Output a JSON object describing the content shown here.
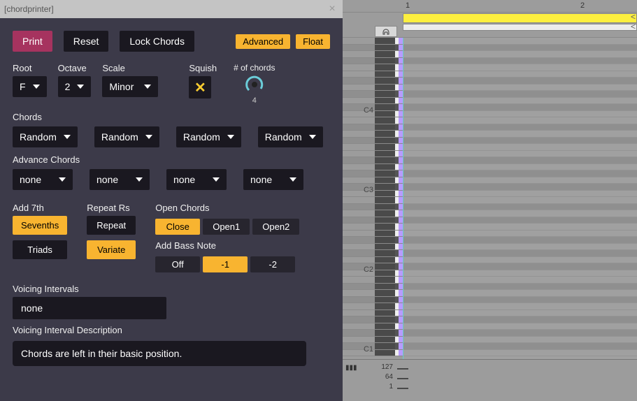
{
  "titlebar": {
    "text": "[chordprinter]"
  },
  "toolbar": {
    "print": "Print",
    "reset": "Reset",
    "lock": "Lock Chords",
    "advanced": "Advanced",
    "float": "Float"
  },
  "root": {
    "label": "Root",
    "value": "F"
  },
  "octave": {
    "label": "Octave",
    "value": "2"
  },
  "scale": {
    "label": "Scale",
    "value": "Minor"
  },
  "squish": {
    "label": "Squish"
  },
  "numChords": {
    "label": "# of chords",
    "value": "4"
  },
  "chords": {
    "label": "Chords",
    "slots": [
      "Random",
      "Random",
      "Random",
      "Random"
    ]
  },
  "advanceChords": {
    "label": "Advance Chords",
    "slots": [
      "none",
      "none",
      "none",
      "none"
    ]
  },
  "add7th": {
    "label": "Add 7th",
    "sevenths": "Sevenths",
    "triads": "Triads"
  },
  "repeatRs": {
    "label": "Repeat Rs",
    "repeat": "Repeat",
    "variate": "Variate"
  },
  "openChords": {
    "label": "Open Chords",
    "options": [
      "Close",
      "Open1",
      "Open2"
    ],
    "active": 0
  },
  "addBass": {
    "label": "Add Bass Note",
    "options": [
      "Off",
      "-1",
      "-2"
    ],
    "active": 1
  },
  "voicing": {
    "label": "Voicing Intervals",
    "value": "none",
    "descLabel": "Voicing Interval Description",
    "desc": "Chords are left in their basic position."
  },
  "ruler": {
    "bars": [
      "1",
      "2"
    ]
  },
  "pianoLabels": {
    "c4": "C4",
    "c3": "C3",
    "c2": "C2",
    "c1": "C1"
  },
  "velocity": {
    "labels": [
      "127",
      "64",
      "1"
    ]
  }
}
